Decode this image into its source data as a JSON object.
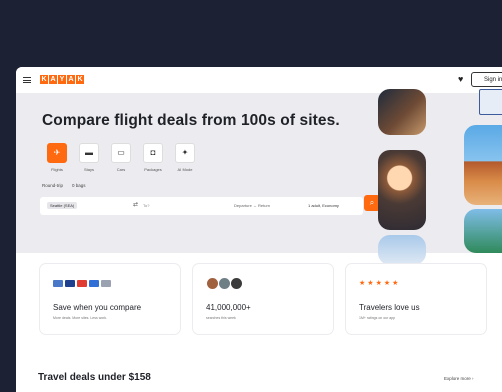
{
  "header": {
    "logo_letters": [
      "K",
      "A",
      "Y",
      "A",
      "K"
    ],
    "signin_label": "Sign in"
  },
  "hero": {
    "title": "Compare flight deals from 100s of sites.",
    "verticals": [
      {
        "label": "Flights",
        "icon": "plane-icon"
      },
      {
        "label": "Stays",
        "icon": "bed-icon"
      },
      {
        "label": "Cars",
        "icon": "car-icon"
      },
      {
        "label": "Packages",
        "icon": "suitcase-icon"
      },
      {
        "label": "AI Mode",
        "icon": "sparkle-icon"
      }
    ],
    "trip_type": "Round-trip",
    "bags": "0 bags",
    "origin": "Seattle (SEA)",
    "destination_placeholder": "To?",
    "dates": "Departure  ↔  Return",
    "passengers": "1 adult, Economy"
  },
  "cards": [
    {
      "title": "Save when you compare",
      "subtitle": "More deals. More sites. Less work."
    },
    {
      "title": "41,000,000+",
      "subtitle": "searches this week"
    },
    {
      "title": "Travelers love us",
      "subtitle": "1M+ ratings on our app"
    }
  ],
  "deals": {
    "title": "Travel deals under $158",
    "explore_label": "Explore more ›"
  },
  "colors": {
    "accent": "#ff690f",
    "backdrop": "#1d2134",
    "hero_bg": "#ececf0"
  }
}
